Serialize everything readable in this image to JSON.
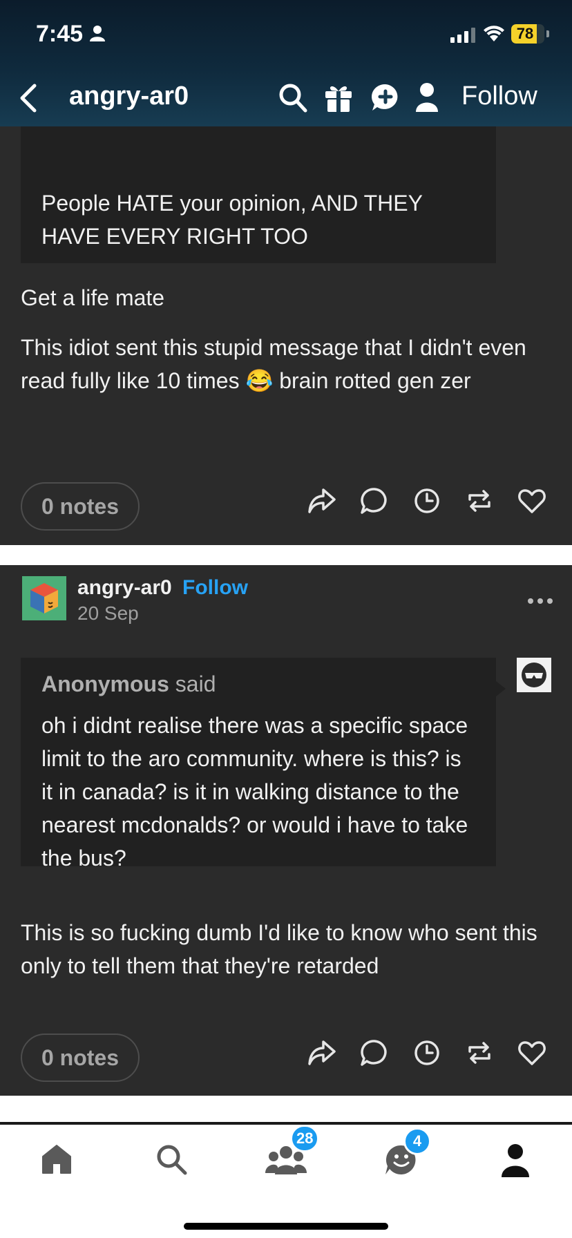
{
  "status_bar": {
    "time": "7:45",
    "battery": "78",
    "battery_level": 0.78
  },
  "nav": {
    "title": "angry-ar0",
    "follow_label": "Follow"
  },
  "posts": [
    {
      "quote_text": "People HATE your opinion, AND THEY HAVE EVERY RIGHT TOO",
      "paragraphs": [
        "Get a life mate",
        "This idiot sent this stupid message that I didn't even read fully like 10 times 😂 brain rotted gen zer"
      ],
      "notes": "0 notes"
    },
    {
      "author": "angry-ar0",
      "follow_label": "Follow",
      "date": "20 Sep",
      "asker_name": "Anonymous",
      "asker_verb": " said",
      "question": "oh i didnt realise there was a specific space limit to the aro community. where is this? is it in canada? is it in walking distance to the nearest mcdonalds? or would i have to take the bus?",
      "answer": "This is so fucking dumb I'd like to know who sent this only to tell them that they're retarded",
      "notes": "0 notes"
    }
  ],
  "tabbar": {
    "communities_badge": "28",
    "activity_badge": "4"
  },
  "icons": [
    "back-icon",
    "search-icon",
    "gift-icon",
    "new-post-icon",
    "user-icon",
    "share-icon",
    "reply-icon",
    "queue-icon",
    "reblog-icon",
    "like-icon",
    "home-icon",
    "communities-icon",
    "activity-icon",
    "account-icon"
  ],
  "colors": {
    "accent_blue": "#27a2f4",
    "card_bg": "#2b2b2b",
    "quote_bg": "#212121",
    "header_dark": "#0f2a3d",
    "badge_blue": "#1a9bf0",
    "battery_yellow": "#f5d12a"
  }
}
